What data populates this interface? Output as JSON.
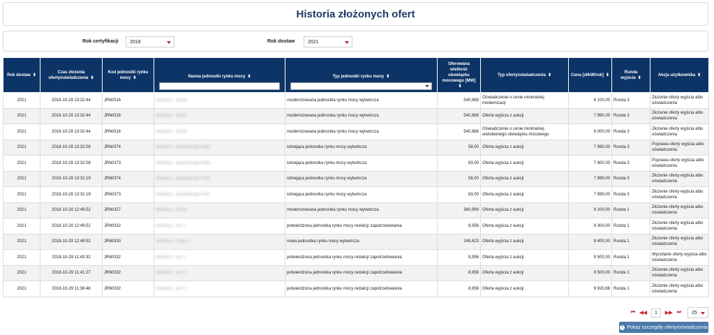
{
  "page": {
    "title": "Historia złożonych ofert"
  },
  "filters": {
    "cert_year_label": "Rok certyfikacji",
    "cert_year_value": "2018",
    "delivery_year_label": "Rok dostaw",
    "delivery_year_value": "2021"
  },
  "columns": [
    "Rok dostaw",
    "Czas złożenia oferty/oświadczenia",
    "Kod jednostki rynku mocy",
    "Nazwa jednostki rynku mocy",
    "Typ jednostki rynku mocy",
    "Oferowana wielkość obowiązku mocowego [MW]",
    "Typ oferty/oświadczenia",
    "Cena [zł/kW/rok]",
    "Runda wyjścia",
    "Akcja użytkownika"
  ],
  "rows": [
    {
      "year": "2021",
      "time": "2018-10-29 13:32:44",
      "code": "JRM/316",
      "name": "Wielkość - wrzek",
      "type": "modernizowana jednostka rynku mocy wytwórcza",
      "mw": "540,888",
      "offer": "Oświadczenie o cenie minimalnej modernizacji",
      "price": "8 100,00",
      "round": "Runda 3",
      "action": "Złożenie oferty wyjścia albo oświadczenia"
    },
    {
      "year": "2021",
      "time": "2018-10-29 13:32:44",
      "code": "JRM/316",
      "name": "Wielkość - wrzek",
      "type": "modernizowana jednostka rynku mocy wytwórcza",
      "mw": "540,888",
      "offer": "Oferta wyjścia z aukcji",
      "price": "7 990,00",
      "round": "Runda 3",
      "action": "Złożenie oferty wyjścia albo oświadczenia"
    },
    {
      "year": "2021",
      "time": "2018-10-29 13:32:44",
      "code": "JRM/316",
      "name": "Wielkość - wrzek",
      "type": "modernizowana jednostka rynku mocy wytwórcza",
      "mw": "540,888",
      "offer": "Oświadczenie o cenie minimalnej wieloletniego obowiązku mocowego",
      "price": "8 000,00",
      "round": "Runda 3",
      "action": "Złożenie oferty wyjścia albo oświadczenia"
    },
    {
      "year": "2021",
      "time": "2018-10-29 13:32:08",
      "code": "JRM/374",
      "name": "Wielkość - jednostkowy RRM",
      "type": "istniejąca jednostka rynku mocy wytwórcza",
      "mw": "58,00",
      "offer": "Oferta wyjścia z aukcji",
      "price": "7 990,00",
      "round": "Runda 3",
      "action": "Poprawa oferty wyjścia albo oświadczenia"
    },
    {
      "year": "2021",
      "time": "2018-10-29 13:32:08",
      "code": "JRM/373",
      "name": "Wielkość - jednostkowy RRM",
      "type": "istniejąca jednostka rynku mocy wytwórcza",
      "mw": "83,00",
      "offer": "Oferta wyjścia z aukcji",
      "price": "7 900,00",
      "round": "Runda 3",
      "action": "Poprawa oferty wyjścia albo oświadczenia"
    },
    {
      "year": "2021",
      "time": "2018-10-29 13:31:19",
      "code": "JRM/374",
      "name": "Wielkość - jednostkowy RRM",
      "type": "istniejąca jednostka rynku mocy wytwórcza",
      "mw": "58,00",
      "offer": "Oferta wyjścia z aukcji",
      "price": "7 999,00",
      "round": "Runda 3",
      "action": "Złożenie oferty wyjścia albo oświadczenia"
    },
    {
      "year": "2021",
      "time": "2018-10-29 13:31:19",
      "code": "JRM/373",
      "name": "Wielkość - jednostkowy RRM",
      "type": "istniejąca jednostka rynku mocy wytwórcza",
      "mw": "83,00",
      "offer": "Oferta wyjścia z aukcji",
      "price": "7 999,00",
      "round": "Runda 3",
      "action": "Złożenie oferty wyjścia albo oświadczenia"
    },
    {
      "year": "2021",
      "time": "2018-10-29 12:49:52",
      "code": "JRM/327",
      "name": "Wielkość - wrzek",
      "type": "modernizowana jednostka rynku mocy wytwórcza",
      "mw": "360,999",
      "offer": "Oferta wyjścia z aukcji",
      "price": "9 200,00",
      "round": "Runda 1",
      "action": "Złożenie oferty wyjścia albo oświadczenia"
    },
    {
      "year": "2021",
      "time": "2018-10-29 12:49:52",
      "code": "JRM/332",
      "name": "Wielkość - dsr 0",
      "type": "potwierdzona jednostka rynku mocy redukcji zapotrzebowania",
      "mw": "8,956",
      "offer": "Oferta wyjścia z aukcji",
      "price": "9 300,00",
      "round": "Runda 1",
      "action": "Złożenie oferty wyjścia albo oświadczenia"
    },
    {
      "year": "2021",
      "time": "2018-10-29 12:49:52",
      "code": "JRM/330",
      "name": "Wielkość - nowy 0",
      "type": "nowa jednostka rynku mocy wytwórcza",
      "mw": "245,623",
      "offer": "Oferta wyjścia z aukcji",
      "price": "9 400,00",
      "round": "Runda 1",
      "action": "Złożenie oferty wyjścia albo oświadczenia"
    },
    {
      "year": "2021",
      "time": "2018-10-29 11:43:32",
      "code": "JRM/332",
      "name": "Wielkość - dsr 0",
      "type": "potwierdzona jednostka rynku mocy redukcji zapotrzebowania",
      "mw": "8,956",
      "offer": "Oferta wyjścia z aukcji",
      "price": "9 500,00",
      "round": "Runda 1",
      "action": "Wycofanie oferty wyjścia albo oświadczenia"
    },
    {
      "year": "2021",
      "time": "2018-10-29 11:41:27",
      "code": "JRM/332",
      "name": "Wielkość - dsr 0",
      "type": "potwierdzona jednostka rynku mocy redukcji zapotrzebowania",
      "mw": "8,956",
      "offer": "Oferta wyjścia z aukcji",
      "price": "9 500,00",
      "round": "Runda 1",
      "action": "Złożenie oferty wyjścia albo oświadczenia"
    },
    {
      "year": "2021",
      "time": "2018-10-29 11:36:48",
      "code": "JRM/332",
      "name": "Wielkość - dsr 0",
      "type": "potwierdzona jednostka rynku mocy redukcji zapotrzebowania",
      "mw": "8,956",
      "offer": "Oferta wyjścia z aukcji",
      "price": "9 920,66",
      "round": "Runda 1",
      "action": "Złożenie oferty wyjścia albo oświadczenia"
    }
  ],
  "pagination": {
    "first": "⏮",
    "prev": "◀◀",
    "current_page": "1",
    "next": "▶▶",
    "last": "⏭",
    "page_size": "25"
  },
  "details_button": {
    "label": "Pokaż szczegóły oferty/oświadczenia"
  },
  "colors": {
    "header_bg": "#0d3466",
    "title": "#1f3864",
    "accent_red": "#c0282d",
    "button_bg": "#4a79a8"
  }
}
